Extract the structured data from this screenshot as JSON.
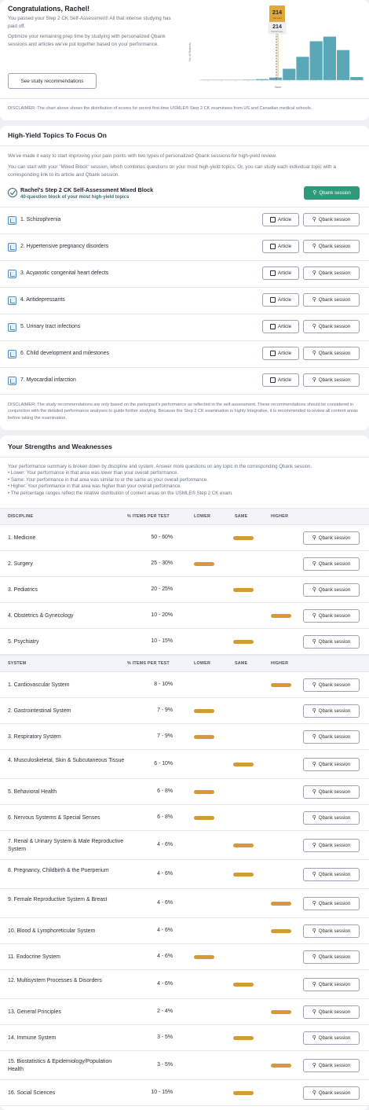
{
  "summary": {
    "title": "Congratulations, Rachel!",
    "para1": "You passed your Step 2 CK Self-Assessment! All that intense studying has paid off.",
    "para2": "Optimize your remaining prep time by studying with personalized Qbank sessions and articles we've put together based on your performance.",
    "button_label": "See study recommendations",
    "disclaimer": "DISCLAIMER: The chart above shows the distribution of scores for recent first-time USMLE® Step 2 CK examinees from US and Canadian medical schools."
  },
  "chart_data": {
    "type": "bar",
    "title": "",
    "xlabel": "Score",
    "ylabel": "No. of Students",
    "score_marker_top": "214",
    "score_marker_top_sub": "Your score",
    "score_marker": "214",
    "score_marker_sub": "Passing score",
    "values": [
      0.3,
      0.3,
      0.5,
      1,
      2,
      5,
      22,
      45,
      75,
      84,
      58,
      6
    ],
    "ylim": [
      0,
      100
    ],
    "colors": {
      "bar": "#5aa7b8",
      "marker": "#e0a73b",
      "passing_line": "#2a2e35"
    }
  },
  "focus": {
    "title": "High-Yield Topics To Focus On",
    "para1": "We've made it easy to start improving your pain points with two types of personalized Qbank sessions for high-yield review.",
    "para2": "You can start with your \"Mixed Block\" session, which combines questions on your most high-yield topics. Or, you can study each individual topic with a corresponding link to its article and Qbank session.",
    "mixed_title": "Rachel's Step 2 CK Self-Assessment Mixed Block",
    "mixed_sub": "40-question block of your most high-yield topics",
    "qbank_label": "Qbank session",
    "article_label": "Article",
    "topics": [
      "1. Schizophrenia",
      "2. Hypertensive pregnancy disorders",
      "3. Acyanotic congenital heart defects",
      "4. Antidepressants",
      "5. Urinary tract infections",
      "6. Child development and milestones",
      "7. Myocardial infarction"
    ],
    "disclaimer": "DISCLAIMER: The study recommendations are only based on the participant's performance as reflected in the self-assessment. These recommendations should be considered in conjunction with the detailed performance analyses to guide further studying. Because the Step 2 CK examination is highly integrative, it is recommended to review all content areas before taking the examination."
  },
  "strengths": {
    "title": "Your Strengths and Weaknesses",
    "intro": [
      "Your performance summary is broken down by discipline and system. Answer more questions on any topic in the corresponding Qbank session.",
      "• Lower: Your performance in that area was lower than your overall performance.",
      "• Same: Your performance in that area was similar to or the same as your overall performance.",
      "• Higher: Your performance in that area was higher than your overall performance.",
      "• The percentage ranges reflect the relative distribution of content areas on the USMLE® Step 2 CK exam."
    ],
    "col_pct": "% ITEMS PER TEST",
    "col_lower": "LOWER",
    "col_same": "SAME",
    "col_higher": "HIGHER",
    "qbank_label": "Qbank session",
    "discipline_header": "DISCIPLINE",
    "system_header": "SYSTEM",
    "disciplines": [
      {
        "name": "1. Medicine",
        "pct": "50 - 60%",
        "level": "same"
      },
      {
        "name": "2. Surgery",
        "pct": "25 - 30%",
        "level": "lower"
      },
      {
        "name": "3. Pediatrics",
        "pct": "20 - 25%",
        "level": "same"
      },
      {
        "name": "4. Obstetrics & Gynecology",
        "pct": "10 - 20%",
        "level": "higher"
      },
      {
        "name": "5. Psychiatry",
        "pct": "10 - 15%",
        "level": "same"
      }
    ],
    "systems": [
      {
        "name": "1. Cardiovascular System",
        "pct": "8 - 10%",
        "level": "higher"
      },
      {
        "name": "2. Gastrointestinal System",
        "pct": "7 - 9%",
        "level": "lower"
      },
      {
        "name": "3. Respiratory System",
        "pct": "7 - 9%",
        "level": "lower"
      },
      {
        "name": "4. Musculoskeletal, Skin & Subcutaneous Tissue",
        "pct": "6 - 10%",
        "level": "same"
      },
      {
        "name": "5. Behavioral Health",
        "pct": "6 - 8%",
        "level": "lower"
      },
      {
        "name": "6. Nervous Systems & Special Senses",
        "pct": "6 - 8%",
        "level": "lower"
      },
      {
        "name": "7. Renal & Urinary System & Male Reproductive System",
        "pct": "4 - 6%",
        "level": "same"
      },
      {
        "name": "8. Pregnancy, Childbirth & the Puerperium",
        "pct": "4 - 6%",
        "level": "same"
      },
      {
        "name": "9. Female Reproductive System & Breast",
        "pct": "4 - 6%",
        "level": "higher"
      },
      {
        "name": "10. Blood & Lymphoreticular System",
        "pct": "4 - 6%",
        "level": "higher"
      },
      {
        "name": "11. Endocrine System",
        "pct": "4 - 6%",
        "level": "lower"
      },
      {
        "name": "12. Multisystem Processes & Disorders",
        "pct": "4 - 6%",
        "level": "same"
      },
      {
        "name": "13. General Principles",
        "pct": "2 - 4%",
        "level": "higher"
      },
      {
        "name": "14. Immune System",
        "pct": "3 - 5%",
        "level": "same"
      },
      {
        "name": "15. Biostatistics & Epidemiology/Population Health",
        "pct": "3 - 5%",
        "level": "higher"
      },
      {
        "name": "16. Social Sciences",
        "pct": "10 - 15%",
        "level": "same"
      }
    ]
  }
}
